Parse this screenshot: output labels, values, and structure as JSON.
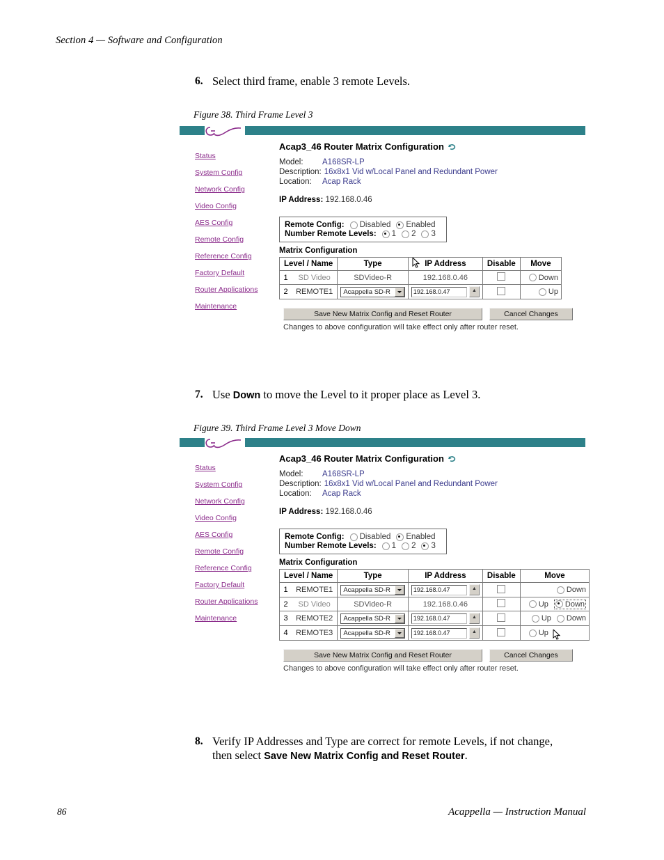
{
  "page": {
    "section_header": "Section 4 — Software and Configuration",
    "footer_page_number": "86",
    "footer_title": "Acappella  —  Instruction Manual"
  },
  "steps": [
    {
      "number": "6.",
      "text_before": "Select third frame, enable 3 remote Levels.",
      "bold": "",
      "text_after": ""
    },
    {
      "number": "7.",
      "text_before": "Use ",
      "bold": "Down",
      "text_after": " to move the Level to it proper place as Level 3."
    },
    {
      "number": "8.",
      "text_before": "Verify IP Addresses and Type are correct for remote Levels, if not change, then select ",
      "bold": "Save New Matrix Config and Reset Router",
      "text_after": "."
    }
  ],
  "figures": [
    {
      "caption": "Figure 38.  Third Frame Level 3",
      "title": "Acap3_46 Router Matrix Configuration",
      "refresh_icon": "refresh-icon",
      "logo_icon": "grass-valley-logo",
      "nav_items": [
        "Status",
        "System Config",
        "Network Config",
        "Video Config",
        "AES Config",
        "Remote Config",
        "Reference Config",
        "Factory Default",
        "Router Applications",
        "Maintenance"
      ],
      "meta": [
        {
          "label": "Model:",
          "value": "A168SR-LP"
        },
        {
          "label": "Description:",
          "value": "16x8x1 Vid w/Local Panel and Redundant Power"
        },
        {
          "label": "Location:",
          "value": "Acap Rack"
        }
      ],
      "ip_label": "IP Address:",
      "ip_value": "192.168.0.46",
      "remote_config": {
        "label": "Remote Config:",
        "options": [
          "Disabled",
          "Enabled"
        ],
        "selected": "Enabled"
      },
      "remote_levels": {
        "label": "Number Remote Levels:",
        "options": [
          "1",
          "2",
          "3"
        ],
        "selected": "1"
      },
      "matrix_title": "Matrix Configuration",
      "columns": [
        "Level / Name",
        "Type",
        "IP Address",
        "Disable",
        "Move"
      ],
      "rows": [
        {
          "level": "1",
          "name": "SD Video",
          "name_dim": true,
          "type": "SDVideo-R",
          "type_is_select": false,
          "ip": "192.168.0.46",
          "ip_is_input": false,
          "disabled_checked": false,
          "move": [
            "Down"
          ],
          "move_focused": ""
        },
        {
          "level": "2",
          "name": "REMOTE1",
          "name_dim": false,
          "type": "Acappella SD-R",
          "type_is_select": true,
          "ip": "192.168.0.47",
          "ip_is_input": true,
          "disabled_checked": false,
          "move": [
            "Up"
          ],
          "move_focused": ""
        }
      ],
      "save_button": "Save New Matrix Config and Reset Router",
      "cancel_button": "Cancel Changes",
      "note": "Changes to above configuration will take effect only after router reset."
    },
    {
      "caption": "Figure 39.  Third Frame Level 3 Move Down",
      "title": "Acap3_46 Router Matrix Configuration",
      "refresh_icon": "refresh-icon",
      "logo_icon": "grass-valley-logo",
      "nav_items": [
        "Status",
        "System Config",
        "Network Config",
        "Video Config",
        "AES Config",
        "Remote Config",
        "Reference Config",
        "Factory Default",
        "Router Applications",
        "Maintenance"
      ],
      "meta": [
        {
          "label": "Model:",
          "value": "A168SR-LP"
        },
        {
          "label": "Description:",
          "value": "16x8x1 Vid w/Local Panel and Redundant Power"
        },
        {
          "label": "Location:",
          "value": "Acap Rack"
        }
      ],
      "ip_label": "IP Address:",
      "ip_value": "192.168.0.46",
      "remote_config": {
        "label": "Remote Config:",
        "options": [
          "Disabled",
          "Enabled"
        ],
        "selected": "Enabled"
      },
      "remote_levels": {
        "label": "Number Remote Levels:",
        "options": [
          "1",
          "2",
          "3"
        ],
        "selected": "3"
      },
      "matrix_title": "Matrix Configuration",
      "columns": [
        "Level / Name",
        "Type",
        "IP Address",
        "Disable",
        "Move"
      ],
      "rows": [
        {
          "level": "1",
          "name": "REMOTE1",
          "name_dim": false,
          "type": "Acappella SD-R",
          "type_is_select": true,
          "ip": "192.168.0.47",
          "ip_is_input": true,
          "disabled_checked": false,
          "move": [
            "Down"
          ],
          "move_focused": ""
        },
        {
          "level": "2",
          "name": "SD Video",
          "name_dim": true,
          "type": "SDVideo-R",
          "type_is_select": false,
          "ip": "192.168.0.46",
          "ip_is_input": false,
          "disabled_checked": false,
          "move": [
            "Up",
            "Down"
          ],
          "move_focused": "Down"
        },
        {
          "level": "3",
          "name": "REMOTE2",
          "name_dim": false,
          "type": "Acappella SD-R",
          "type_is_select": true,
          "ip": "192.168.0.47",
          "ip_is_input": true,
          "disabled_checked": false,
          "move": [
            "Up",
            "Down"
          ],
          "move_focused": ""
        },
        {
          "level": "4",
          "name": "REMOTE3",
          "name_dim": false,
          "type": "Acappella SD-R",
          "type_is_select": true,
          "ip": "192.168.0.47",
          "ip_is_input": true,
          "disabled_checked": false,
          "move": [
            "Up"
          ],
          "move_focused": ""
        }
      ],
      "save_button": "Save New Matrix Config and Reset Router",
      "cancel_button": "Cancel Changes",
      "note": "Changes to above configuration will take effect only after router reset."
    }
  ],
  "colors": {
    "titlebar_teal": "#2d8189",
    "link_purple": "#8b2b8b",
    "meta_value_blue": "#3a3a8c",
    "button_face": "#d4d0c8"
  }
}
